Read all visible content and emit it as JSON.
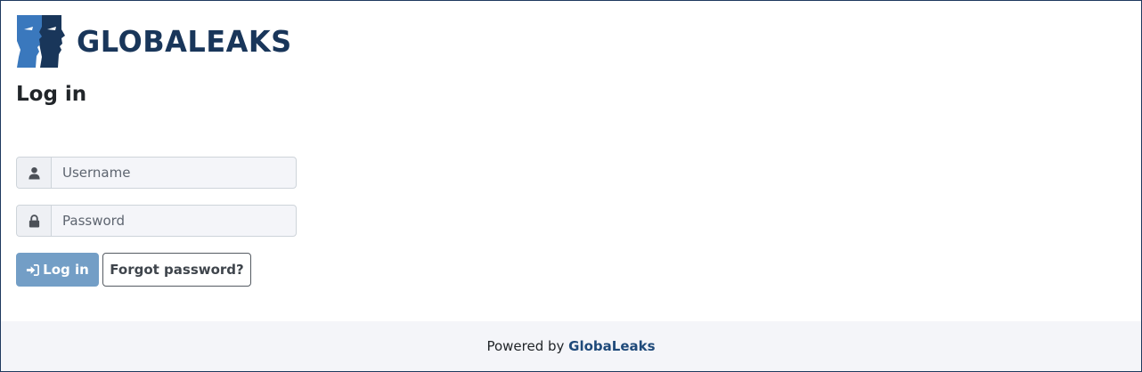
{
  "brand": {
    "name": "GLOBALEAKS",
    "logo_icon": "globaleaks-faces-logo",
    "primary_color": "#19365a",
    "secondary_color": "#3a78bd"
  },
  "page": {
    "title": "Log in"
  },
  "form": {
    "username": {
      "icon": "user-icon",
      "placeholder": "Username",
      "value": ""
    },
    "password": {
      "icon": "lock-icon",
      "placeholder": "Password",
      "value": ""
    },
    "login_button": {
      "icon": "sign-in-icon",
      "label": "Log in",
      "color": "#739ec6"
    },
    "forgot_button": {
      "label": "Forgot password?"
    }
  },
  "footer": {
    "prefix": "Powered by",
    "link_label": "GlobaLeaks",
    "link_color": "#1f4a7a"
  }
}
